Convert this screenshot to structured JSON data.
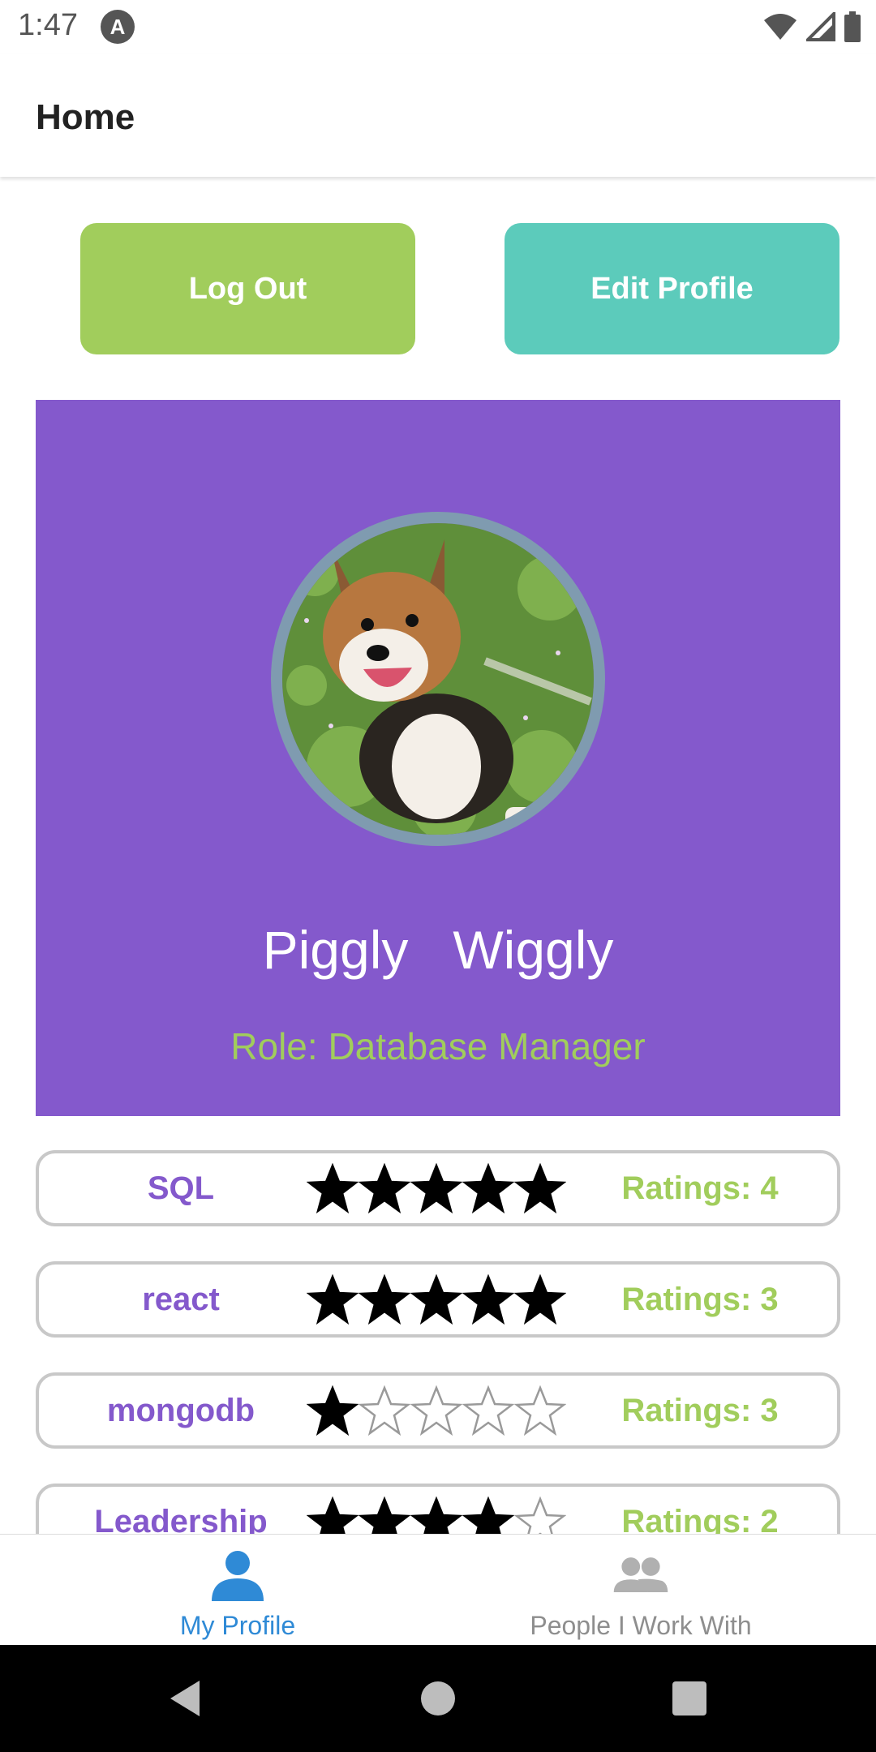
{
  "status_bar": {
    "time": "1:47",
    "app_icon": "A"
  },
  "app_bar": {
    "title": "Home"
  },
  "actions": {
    "logout_label": "Log Out",
    "edit_label": "Edit Profile"
  },
  "profile": {
    "first_name": "Piggly",
    "last_name": "Wiggly",
    "name_display": "Piggly   Wiggly",
    "role": "Role: Database Manager",
    "avatar": "corgi-photo"
  },
  "skills": [
    {
      "name": "SQL",
      "stars": 5,
      "ratings": "Ratings: 4"
    },
    {
      "name": "react",
      "stars": 5,
      "ratings": "Ratings: 3"
    },
    {
      "name": "mongodb",
      "stars": 1,
      "ratings": "Ratings: 3"
    },
    {
      "name": "Leadership",
      "stars": 4,
      "ratings": "Ratings: 2"
    }
  ],
  "tabs": [
    {
      "label": "My Profile",
      "icon": "person-icon",
      "active": true
    },
    {
      "label": "People I Work With",
      "icon": "people-icon",
      "active": false
    }
  ],
  "colors": {
    "accent_green": "#a1cd5c",
    "accent_teal": "#5ccbbb",
    "card_purple": "#8459cc",
    "tab_active": "#2f8ad6",
    "tab_inactive": "#8e8e8e"
  }
}
